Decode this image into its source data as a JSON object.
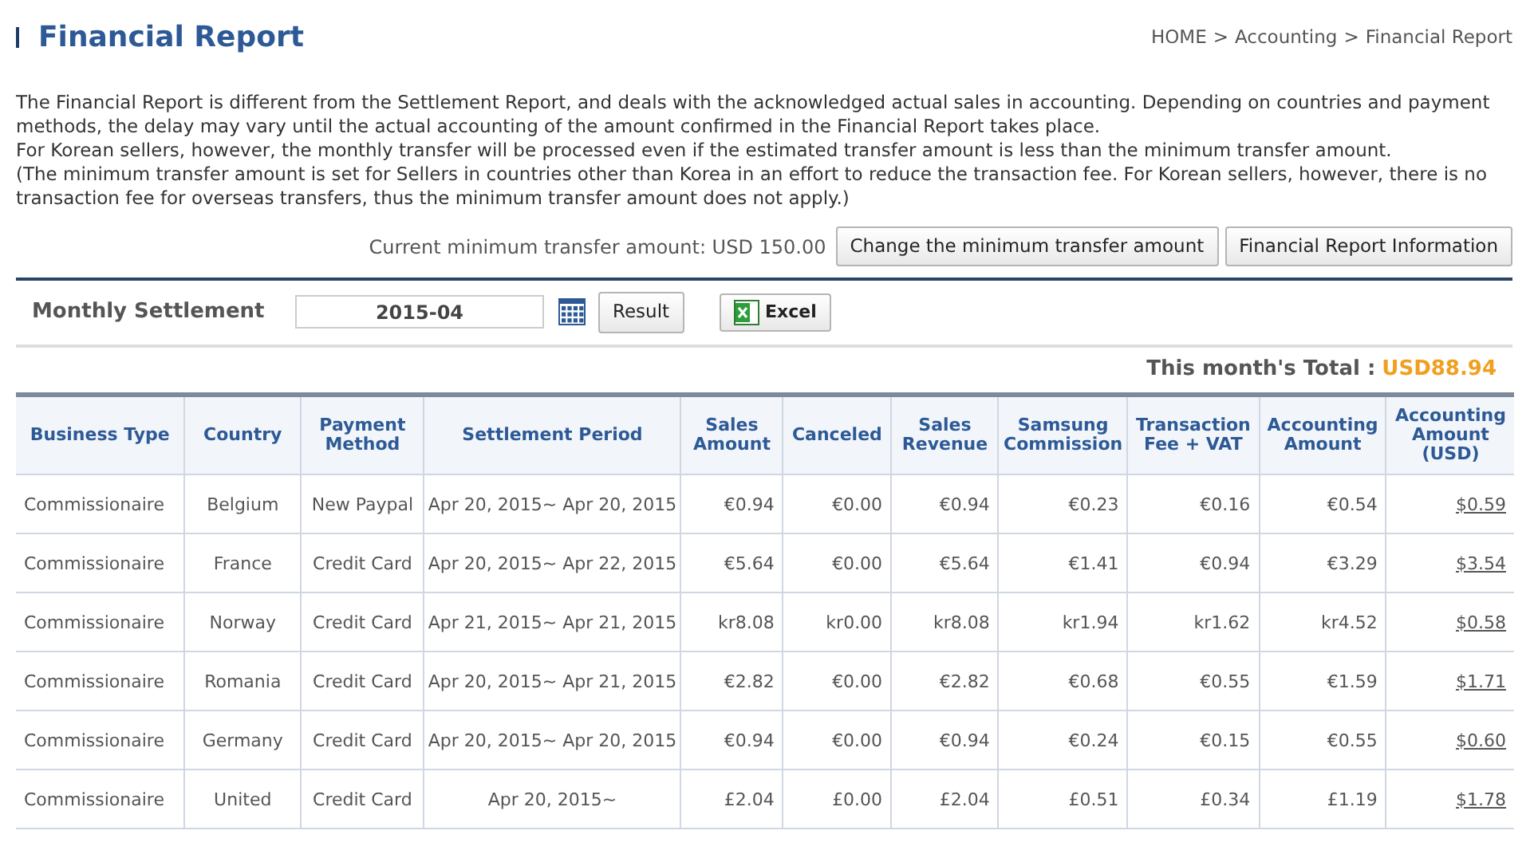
{
  "page_title": "Financial Report",
  "breadcrumb": [
    "HOME",
    "Accounting",
    "Financial Report"
  ],
  "breadcrumb_separator": ">",
  "intro": [
    "The Financial Report is different from the Settlement Report, and deals with the acknowledged actual sales in accounting. Depending on countries and payment methods, the delay may vary until the actual accounting of the amount confirmed in the Financial Report takes place.",
    "For Korean sellers, however, the monthly transfer will be processed even if the estimated transfer amount is less than the minimum transfer amount.",
    "(The minimum transfer amount is set for Sellers in countries other than Korea in an effort to reduce the transaction fee. For Korean sellers, however, there is no transaction fee for overseas transfers, thus the minimum transfer amount does not apply.)"
  ],
  "minimum_transfer": "Current minimum transfer amount: USD 150.00",
  "action_buttons": [
    "Change the minimum transfer amount",
    "Financial Report Information"
  ],
  "filter": {
    "label": "Monthly Settlement",
    "month": "2015-04",
    "result_button": "Result",
    "excel_button": "Excel"
  },
  "total": {
    "label": "This month's Total :",
    "value": "USD88.94"
  },
  "table": {
    "columns": [
      "Business Type",
      "Country",
      "Payment Method",
      "Settlement Period",
      "Sales Amount",
      "Canceled",
      "Sales Revenue",
      "Samsung Commission",
      "Transaction Fee + VAT",
      "Accounting Amount",
      "Accounting Amount (USD)"
    ],
    "rows": [
      [
        "Commissionaire",
        "Belgium",
        "New Paypal",
        "Apr 20, 2015~ Apr 20, 2015",
        "€0.94",
        "€0.00",
        "€0.94",
        "€0.23",
        "€0.16",
        "€0.54",
        "$0.59"
      ],
      [
        "Commissionaire",
        "France",
        "Credit Card",
        "Apr 20, 2015~ Apr 22, 2015",
        "€5.64",
        "€0.00",
        "€5.64",
        "€1.41",
        "€0.94",
        "€3.29",
        "$3.54"
      ],
      [
        "Commissionaire",
        "Norway",
        "Credit Card",
        "Apr 21, 2015~ Apr 21, 2015",
        "kr8.08",
        "kr0.00",
        "kr8.08",
        "kr1.94",
        "kr1.62",
        "kr4.52",
        "$0.58"
      ],
      [
        "Commissionaire",
        "Romania",
        "Credit Card",
        "Apr 20, 2015~ Apr 21, 2015",
        "€2.82",
        "€0.00",
        "€2.82",
        "€0.68",
        "€0.55",
        "€1.59",
        "$1.71"
      ],
      [
        "Commissionaire",
        "Germany",
        "Credit Card",
        "Apr 20, 2015~ Apr 20, 2015",
        "€0.94",
        "€0.00",
        "€0.94",
        "€0.24",
        "€0.15",
        "€0.55",
        "$0.60"
      ],
      [
        "Commissionaire",
        "United",
        "Credit Card",
        "Apr 20, 2015~",
        "£2.04",
        "£0.00",
        "£2.04",
        "£0.51",
        "£0.34",
        "£1.19",
        "$1.78"
      ]
    ]
  }
}
